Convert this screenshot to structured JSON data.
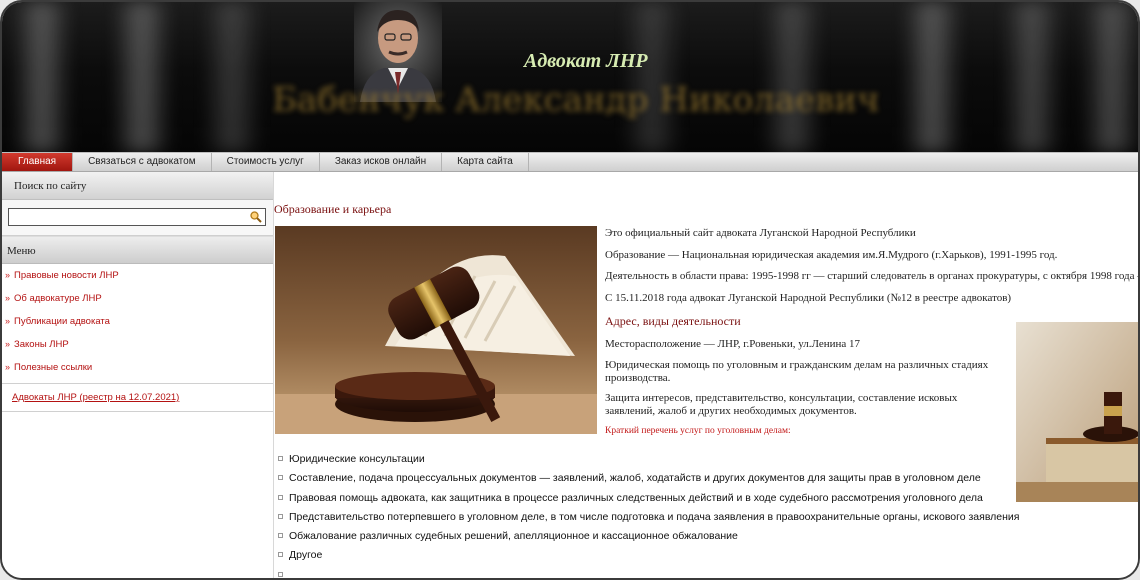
{
  "header": {
    "site_title": "Адвокат ЛНР",
    "name_banner": "Бабенчук Александр Николаевич"
  },
  "nav": {
    "items": [
      {
        "label": "Главная",
        "active": true
      },
      {
        "label": "Связаться с адвокатом",
        "active": false
      },
      {
        "label": "Стоимость услуг",
        "active": false
      },
      {
        "label": "Заказ исков онлайн",
        "active": false
      },
      {
        "label": "Карта сайта",
        "active": false
      }
    ]
  },
  "sidebar": {
    "search_heading": "Поиск по сайту",
    "search_value": "",
    "menu_heading": "Меню",
    "menu_items": [
      "Правовые новости ЛНР",
      "Об адвокатуре ЛНР",
      "Публикации адвоката",
      "Законы ЛНР",
      "Полезные ссылки"
    ],
    "registry_link": "Адвокаты ЛНР (реестр на 12.07.2021)"
  },
  "main": {
    "section_title": "Образование и карьера",
    "intro": "Это официальный сайт адвоката Луганской Народной Республики",
    "education": "Образование — Национальная юридическая академия им.Я.Мудрого (г.Харьков), 1991-1995 год.",
    "career": "Деятельность в области права: 1995-1998 гг — старший следователь в органах прокуратуры, с октября 1998 года —",
    "since": "С 15.11.2018 года адвокат Луганской Народной Республики (№12 в реестре адвокатов)",
    "address_title": "Адрес, виды деятельности",
    "location": "Месторасположение — ЛНР, г.Ровеньки, ул.Ленина 17",
    "help": "Юридическая помощь по уголовным и гражданским делам на различных стадиях производства.",
    "defense": "Защита интересов, представительство, консультации, составление исковых заявлений, жалоб и других необходимых документов.",
    "services_heading": "Краткий перечень услуг по уголовным делам:",
    "services": [
      "Юридические консультации",
      "Составление, подача процессуальных документов — заявлений, жалоб, ходатайств и других документов для защиты прав в уголовном деле",
      "Правовая помощь адвоката, как защитника в процессе различных следственных действий и в ходе судебного рассмотрения уголовного дела",
      "Представительство потерпевшего в уголовном деле, в том числе подготовка и подача заявления в правоохранительные органы, искового заявления",
      "Обжалование различных судебных решений, апелляционное и кассационное обжалование",
      "Другое",
      ""
    ]
  },
  "colors": {
    "accent_red": "#b41212",
    "title_green": "#d7ecb2",
    "heading_maroon": "#7a1010"
  }
}
